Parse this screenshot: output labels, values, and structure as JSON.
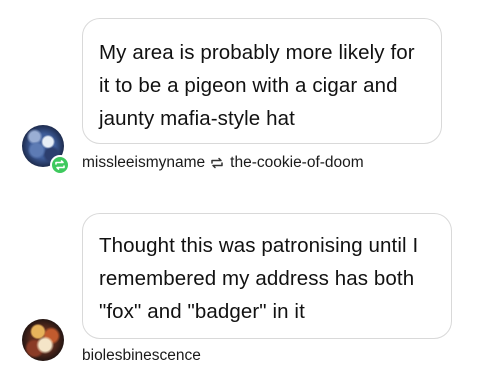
{
  "thread": [
    {
      "message": "My area is probably more likely for it to be a pigeon with a cigar and jaunty mafia-style hat",
      "author": "missleeismyname",
      "reblogged_from": "the-cookie-of-doom",
      "avatar_icon": "avatar-image",
      "badge_icon": "reblog-icon",
      "badge_color": "#3ec95d"
    },
    {
      "message": "Thought this was patronising until I remembered my address has both \"fox\" and \"badger\" in it",
      "author": "biolesbinescence",
      "avatar_icon": "avatar-image"
    }
  ]
}
